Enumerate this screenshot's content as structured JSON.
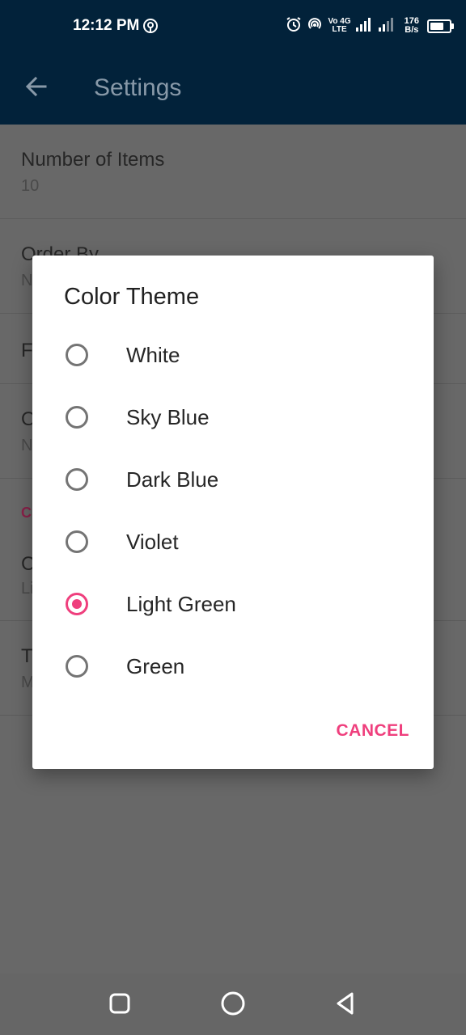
{
  "status_bar": {
    "time": "12:12 PM",
    "network_top": "Vo 4G",
    "network_bottom": "LTE",
    "speed_top": "176",
    "speed_bottom": "B/s",
    "icons": [
      "hotspot-icon",
      "alarm-icon",
      "wifi-hotspot-icon",
      "signal-icon",
      "signal-icon-2",
      "battery-icon"
    ]
  },
  "toolbar": {
    "back_icon": "arrow-back-icon",
    "title": "Settings"
  },
  "settings": {
    "items": [
      {
        "title": "Number of Items",
        "summary": "10"
      },
      {
        "title": "Order By",
        "summary": "N"
      },
      {
        "title": "F",
        "summary": ""
      },
      {
        "title": "O",
        "summary": "N"
      },
      {
        "title": "C",
        "summary": "Li"
      },
      {
        "title": "T",
        "summary": "M"
      }
    ],
    "category_label": "C"
  },
  "dialog": {
    "title": "Color Theme",
    "options": [
      {
        "label": "White",
        "checked": false
      },
      {
        "label": "Sky Blue",
        "checked": false
      },
      {
        "label": "Dark Blue",
        "checked": false
      },
      {
        "label": "Violet",
        "checked": false
      },
      {
        "label": "Light Green",
        "checked": true
      },
      {
        "label": "Green",
        "checked": false
      }
    ],
    "cancel_label": "CANCEL",
    "accent_color": "#ef3f7d"
  },
  "nav_bar": {
    "icons": [
      "recents-square-icon",
      "home-circle-icon",
      "back-triangle-icon"
    ]
  },
  "colors": {
    "appbar": "#02223a",
    "scrim_bg": "#6a6a6a"
  }
}
